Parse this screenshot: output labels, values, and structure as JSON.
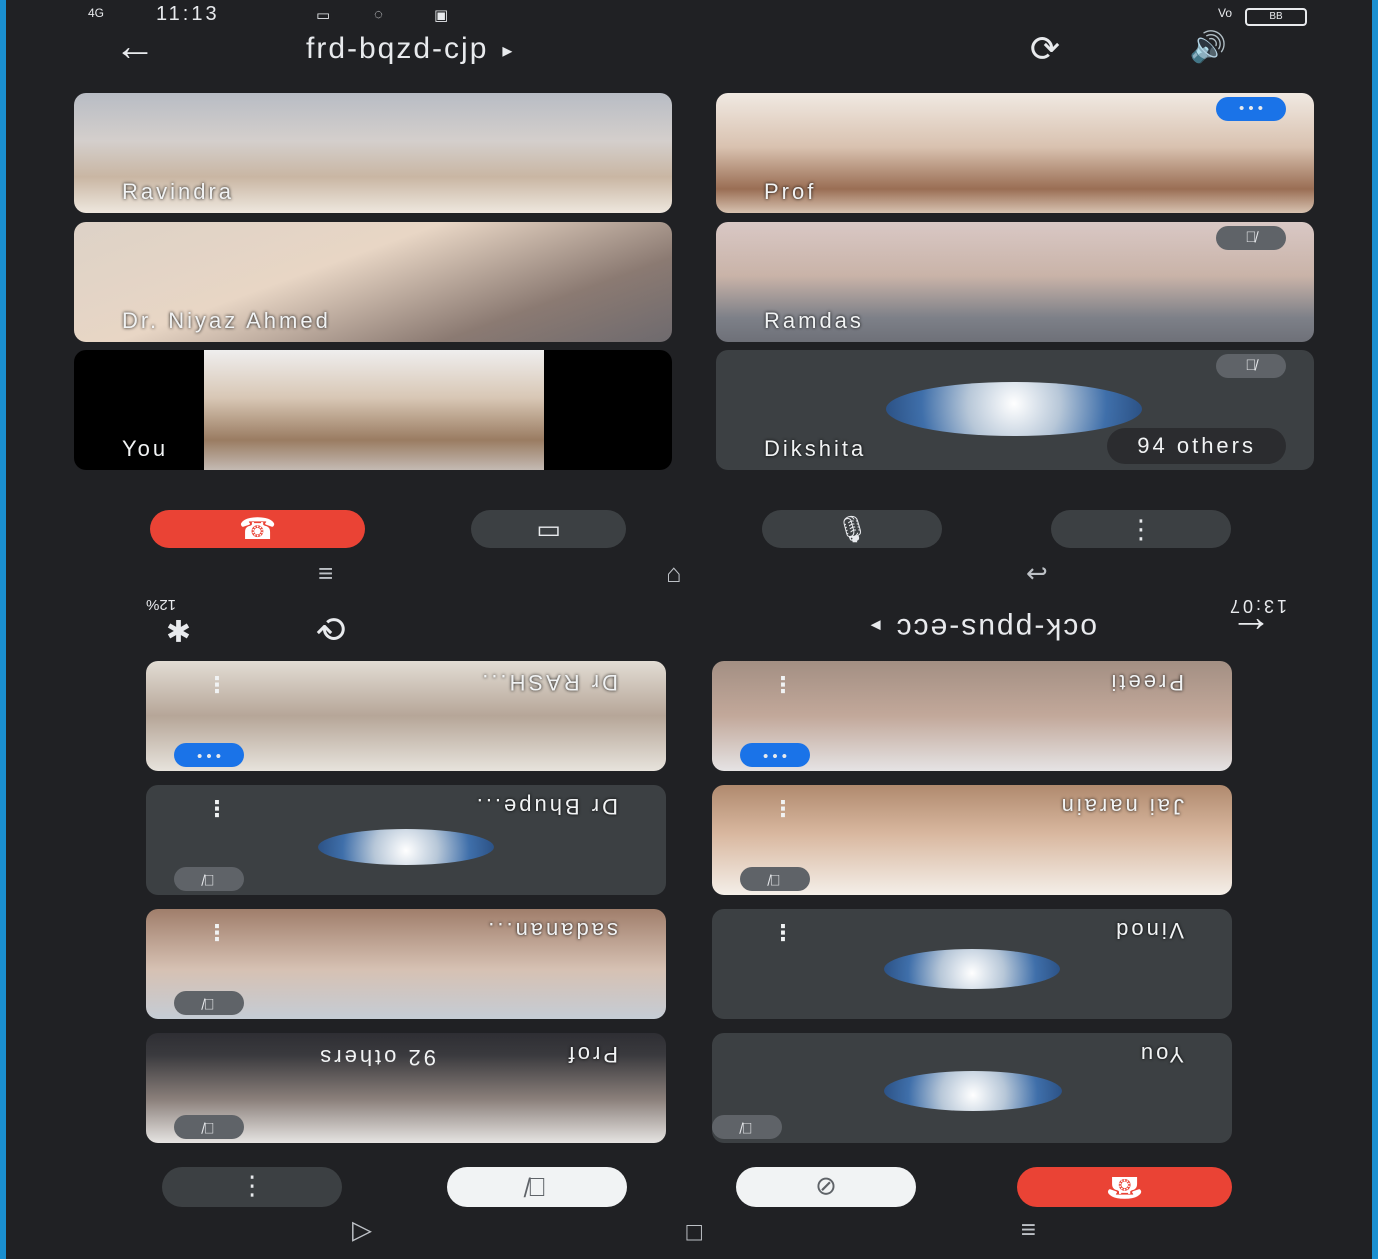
{
  "top": {
    "status": {
      "time": "11:13",
      "signal": "4G",
      "battery": "BB",
      "volte": "Vo"
    },
    "meeting_code": "frd-bqzd-cjp",
    "tiles": [
      {
        "name": "Ravindra",
        "badge": ""
      },
      {
        "name": "Prof",
        "badge": "speaking"
      },
      {
        "name": "Dr. Niyaz Ahmed",
        "badge": ""
      },
      {
        "name": "Ramdas",
        "badge": "muted"
      },
      {
        "name": "You",
        "badge": ""
      },
      {
        "name": "Dikshita",
        "badge": "muted",
        "others": "94 others"
      }
    ]
  },
  "bottom": {
    "status": {
      "time": "13:07",
      "battery": "12%"
    },
    "meeting_code": "ock-ppus-ecc",
    "tiles": [
      {
        "name": "Preeti",
        "badge": "speaking"
      },
      {
        "name": "Dr RASH...",
        "badge": "speaking"
      },
      {
        "name": "Jai narain",
        "badge": "muted"
      },
      {
        "name": "Dr Bhupe...",
        "badge": "muted"
      },
      {
        "name": "Vinod",
        "badge": ""
      },
      {
        "name": "sadanan...",
        "badge": "muted"
      },
      {
        "name": "You",
        "badge": "muted"
      },
      {
        "name": "Prof",
        "badge": "muted",
        "others": "92 others"
      }
    ]
  },
  "icons": {
    "back": "←",
    "caret": "▸",
    "rotate": "⟳",
    "speaker": "🔊",
    "end_call": "☎",
    "camera": "▭",
    "mic": "🎙",
    "more": "⋮",
    "muted": "🎙̸",
    "speaking": "• • •",
    "nav_menu": "≡",
    "nav_home": "⌂",
    "nav_back": "↩",
    "bluetooth": "✱"
  },
  "colors": {
    "end_call": "#ea4335",
    "speaking": "#1a73e8",
    "tile": "#3c4043",
    "bg": "#202124"
  }
}
